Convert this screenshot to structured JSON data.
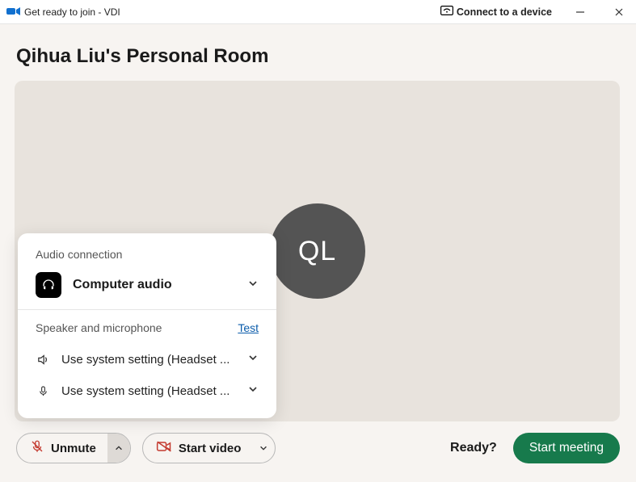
{
  "titlebar": {
    "title": "Get ready to join - VDI",
    "connect_label": "Connect to a device"
  },
  "room": {
    "title": "Qihua Liu's Personal Room",
    "avatar_initials": "QL"
  },
  "audio_popup": {
    "section_title": "Audio connection",
    "mode_label": "Computer audio",
    "speaker_mic_title": "Speaker and microphone",
    "test_link": "Test",
    "speaker_value": "Use system setting (Headset ...",
    "mic_value": "Use system setting (Headset ..."
  },
  "controls": {
    "unmute_label": "Unmute",
    "startvideo_label": "Start video",
    "ready_label": "Ready?",
    "start_meeting_label": "Start meeting"
  },
  "colors": {
    "accent_green": "#177a4c",
    "icon_red": "#c43a2f"
  }
}
